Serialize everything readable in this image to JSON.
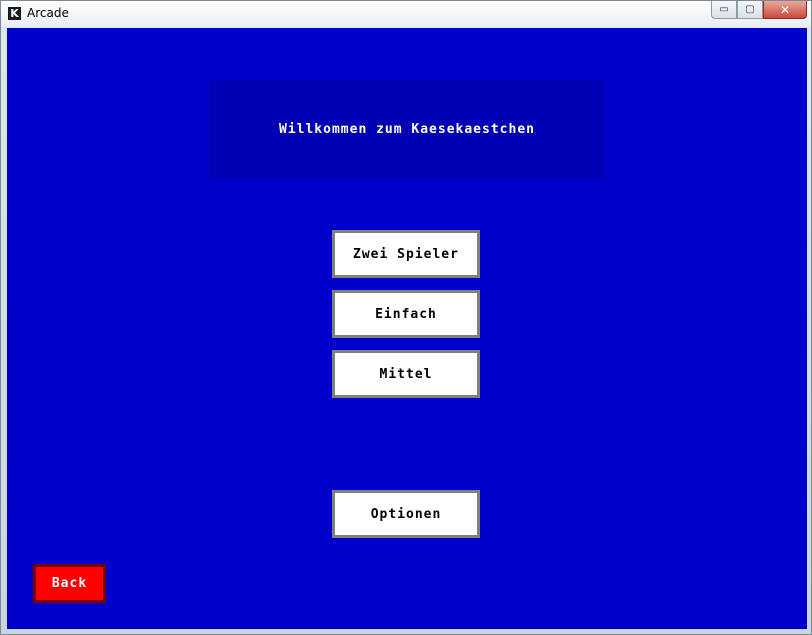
{
  "window": {
    "title": "Arcade",
    "icon_letter": "K",
    "controls": {
      "minimize": "▭",
      "maximize": "▢",
      "close": "✕"
    }
  },
  "game": {
    "background_color": "#0000cc",
    "welcome_text": "Willkommen zum Kaesekaestchen",
    "menu": {
      "two_players": "Zwei Spieler",
      "easy": "Einfach",
      "medium": "Mittel",
      "options": "Optionen"
    },
    "back_label": "Back",
    "back_color": "#ff0000"
  }
}
